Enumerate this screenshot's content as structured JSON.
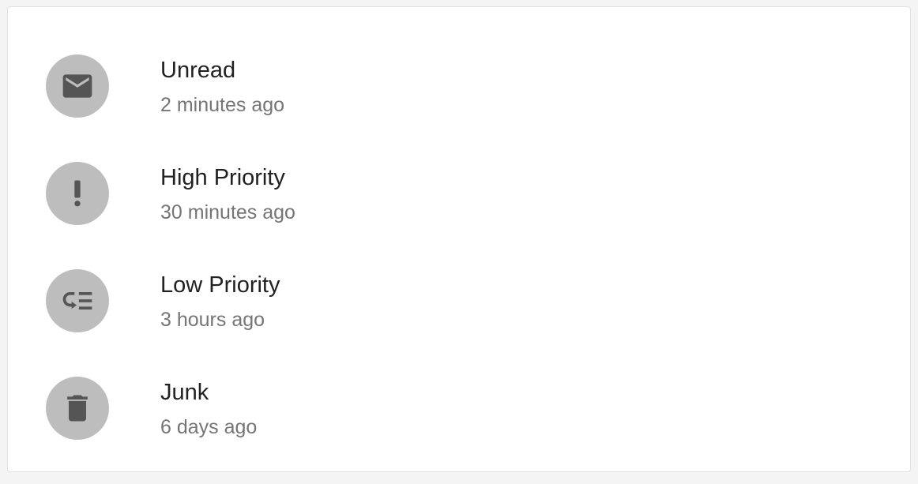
{
  "list": {
    "items": [
      {
        "icon": "mail-icon",
        "title": "Unread",
        "subtitle": "2 minutes ago"
      },
      {
        "icon": "priority-high-icon",
        "title": "High Priority",
        "subtitle": "30 minutes ago"
      },
      {
        "icon": "low-priority-icon",
        "title": "Low Priority",
        "subtitle": "3 hours ago"
      },
      {
        "icon": "delete-icon",
        "title": "Junk",
        "subtitle": "6 days ago"
      }
    ]
  },
  "colors": {
    "avatar_bg": "#bdbdbd",
    "icon": "#555555",
    "primary_text": "#212121",
    "secondary_text": "#757575"
  }
}
